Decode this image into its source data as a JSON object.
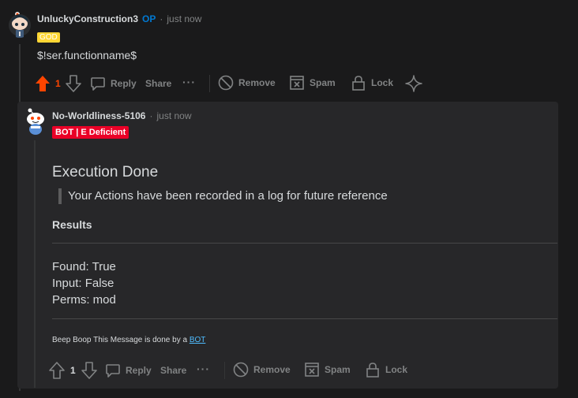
{
  "parent_comment": {
    "username": "UnluckyConstruction3",
    "op_badge": "OP",
    "separator": "·",
    "time": "just now",
    "flair": "GOD",
    "body": "$!ser.functionname$",
    "score": "1",
    "actions": {
      "reply": "Reply",
      "share": "Share",
      "more": "···",
      "remove": "Remove",
      "spam": "Spam",
      "lock": "Lock"
    }
  },
  "reply_comment": {
    "username": "No-Worldliness-5106",
    "separator": "·",
    "time": "just now",
    "flair": "BOT | E Deficient",
    "heading": "Execution Done",
    "quote": "Your Actions have been recorded in a log for future reference",
    "results_label": "Results",
    "results": [
      "Found: True",
      "Input: False",
      "Perms: mod"
    ],
    "footer_text": "Beep Boop This Message is done by a ",
    "footer_link": "BOT",
    "score": "1",
    "actions": {
      "reply": "Reply",
      "share": "Share",
      "more": "···",
      "remove": "Remove",
      "spam": "Spam",
      "lock": "Lock"
    }
  },
  "colors": {
    "background": "#1a1a1b",
    "card": "#272729",
    "upvote_active": "#ff4500",
    "op": "#0079d3",
    "god_flair": "#ffd635",
    "bot_flair": "#ea0027",
    "link": "#4fbcff"
  },
  "icons": [
    "avatar-unlucky",
    "upvote-icon",
    "downvote-icon",
    "comment-icon",
    "more-icon",
    "remove-icon",
    "spam-icon",
    "lock-icon",
    "sparkle-icon",
    "avatar-snoo"
  ]
}
